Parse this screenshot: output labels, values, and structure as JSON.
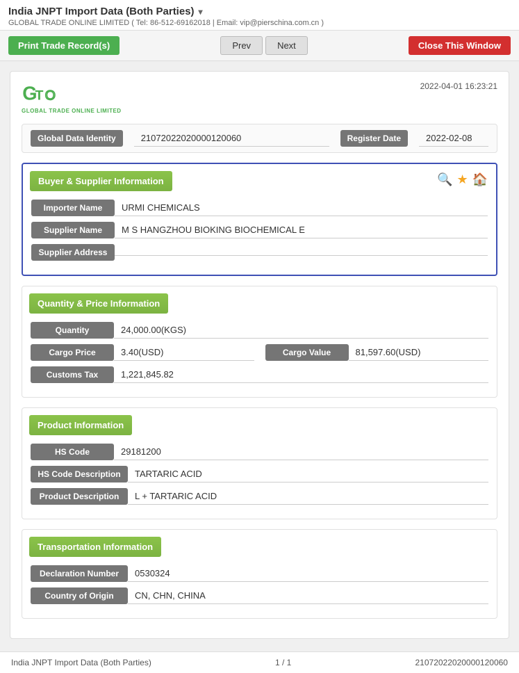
{
  "header": {
    "title": "India JNPT Import Data (Both Parties)",
    "subtitle": "GLOBAL TRADE ONLINE LIMITED ( Tel: 86-512-69162018 | Email: vip@pierschina.com.cn )",
    "datetime": "2022-04-01 16:23:21"
  },
  "toolbar": {
    "print_label": "Print Trade Record(s)",
    "prev_label": "Prev",
    "next_label": "Next",
    "close_label": "Close This Window"
  },
  "global_data": {
    "identity_label": "Global Data Identity",
    "identity_value": "21072022020000120060",
    "register_date_label": "Register Date",
    "register_date_value": "2022-02-08"
  },
  "sections": {
    "buyer_supplier": {
      "title": "Buyer & Supplier Information",
      "importer_label": "Importer Name",
      "importer_value": "URMI CHEMICALS",
      "supplier_label": "Supplier Name",
      "supplier_value": "M S HANGZHOU BIOKING BIOCHEMICAL E",
      "supplier_address_label": "Supplier Address",
      "supplier_address_value": ""
    },
    "quantity_price": {
      "title": "Quantity & Price Information",
      "quantity_label": "Quantity",
      "quantity_value": "24,000.00(KGS)",
      "cargo_price_label": "Cargo Price",
      "cargo_price_value": "3.40(USD)",
      "cargo_value_label": "Cargo Value",
      "cargo_value_value": "81,597.60(USD)",
      "customs_tax_label": "Customs Tax",
      "customs_tax_value": "1,221,845.82"
    },
    "product": {
      "title": "Product Information",
      "hs_code_label": "HS Code",
      "hs_code_value": "29181200",
      "hs_desc_label": "HS Code Description",
      "hs_desc_value": "TARTARIC ACID",
      "product_desc_label": "Product Description",
      "product_desc_value": "L + TARTARIC ACID"
    },
    "transportation": {
      "title": "Transportation Information",
      "declaration_label": "Declaration Number",
      "declaration_value": "0530324",
      "country_label": "Country of Origin",
      "country_value": "CN, CHN, CHINA"
    }
  },
  "footer": {
    "left": "India JNPT Import Data (Both Parties)",
    "center": "1 / 1",
    "right": "21072022020000120060"
  },
  "logo": {
    "text": "GLOBAL TRADE ONLINE LIMITED"
  }
}
